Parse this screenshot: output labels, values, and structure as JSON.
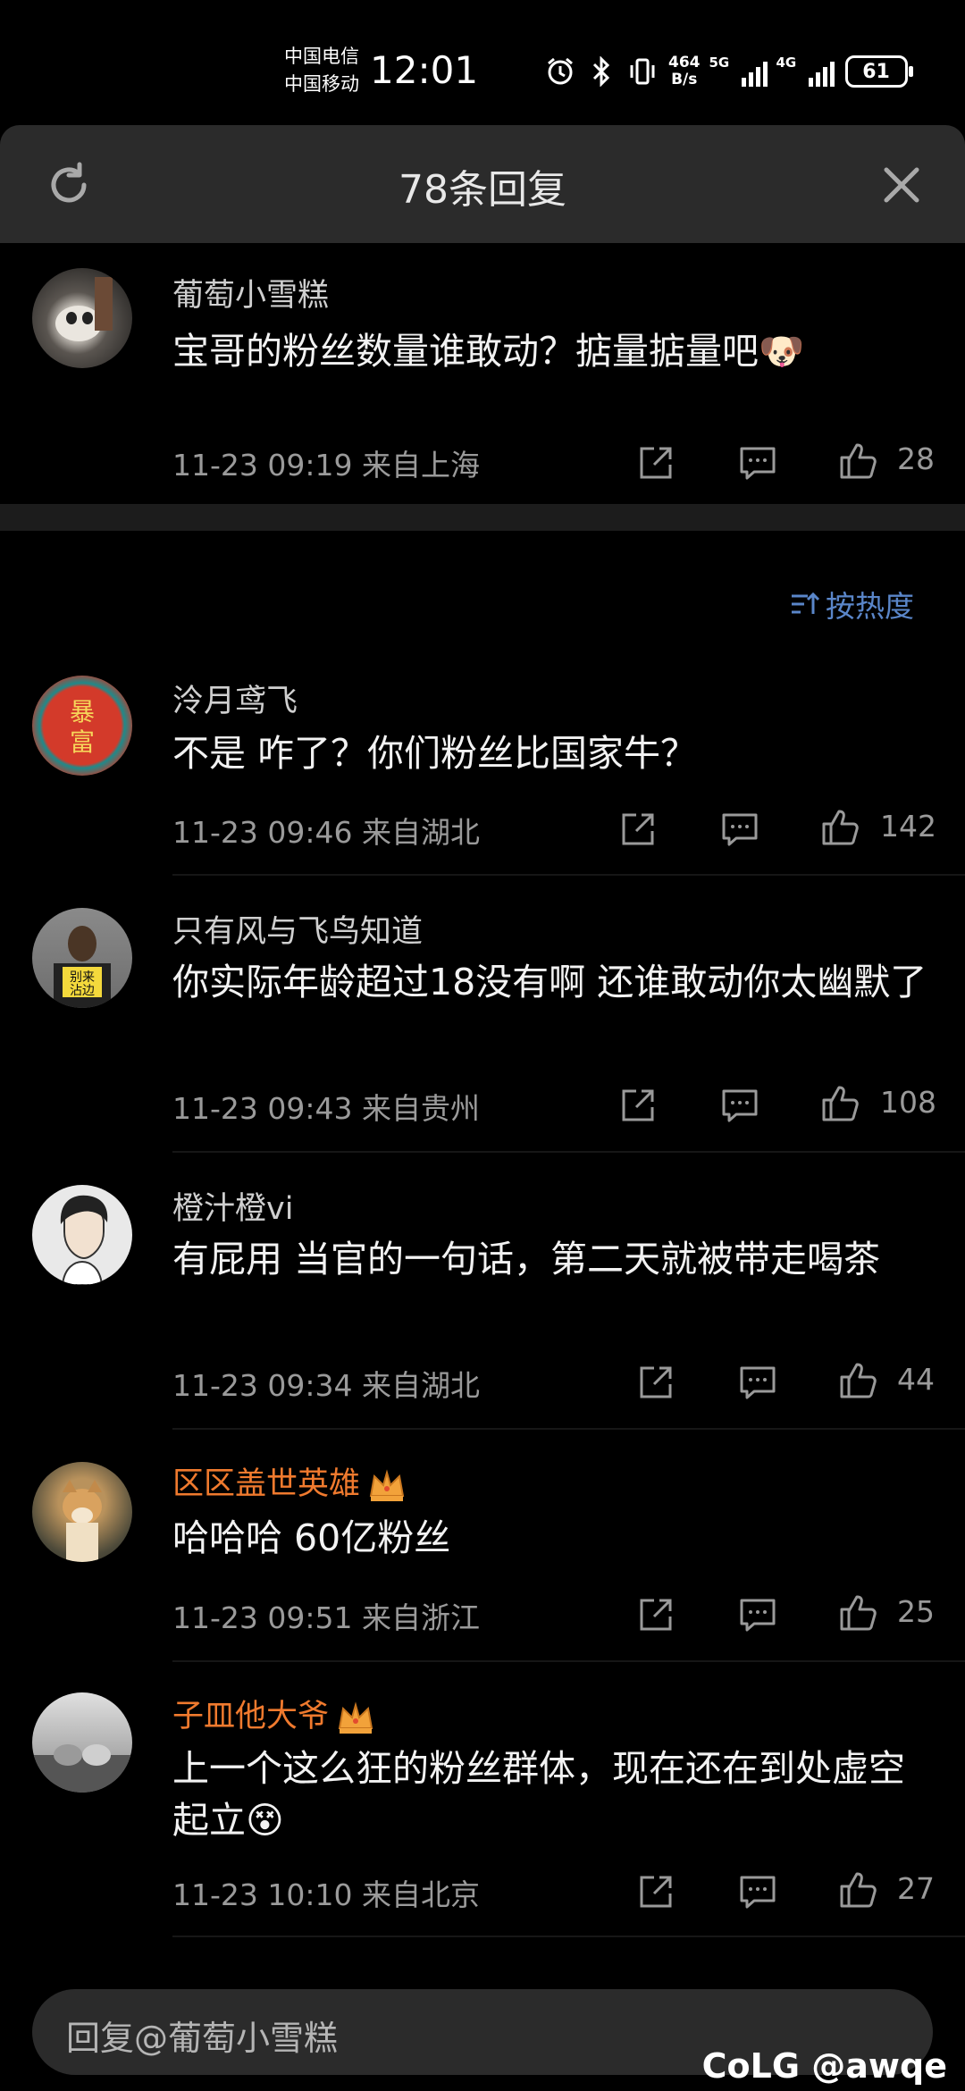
{
  "status_bar": {
    "carrier1": "中国电信",
    "carrier2": "中国移动",
    "time": "12:01",
    "net_speed_value": "464",
    "net_speed_unit": "B/s",
    "signal1": "5G",
    "signal2": "4G",
    "battery": "61"
  },
  "sheet": {
    "title": "78条回复",
    "sort_label": "按热度"
  },
  "main_comment": {
    "author": "葡萄小雪糕",
    "text": "宝哥的粉丝数量谁敢动？掂量掂量吧",
    "emoji": "🐶",
    "date": "11-23 09:19",
    "location": "来自上海",
    "likes": "28"
  },
  "replies": [
    {
      "author": "泠月鸢飞",
      "text": "不是 咋了？你们粉丝比国家牛？",
      "date": "11-23 09:46",
      "location": "来自湖北",
      "likes": "142"
    },
    {
      "author": "只有风与飞鸟知道",
      "text": "你实际年龄超过18没有啊 还谁敢动你太幽默了",
      "date": "11-23 09:43",
      "location": "来自贵州",
      "likes": "108"
    },
    {
      "author": "橙汁橙vi",
      "text": "有屁用 当官的一句话，第二天就被带走喝茶",
      "date": "11-23 09:34",
      "location": "来自湖北",
      "likes": "44"
    },
    {
      "author": "区区盖世英雄",
      "text": "哈哈哈 60亿粉丝",
      "date": "11-23 09:51",
      "location": "来自浙江",
      "likes": "25"
    },
    {
      "author": "子皿他大爷",
      "text": "上一个这么狂的粉丝群体，现在还在到处虚空起立",
      "emoji": "😵",
      "date": "11-23 10:10",
      "location": "来自北京",
      "likes": "27"
    }
  ],
  "reply_bar": {
    "placeholder": "回复@葡萄小雪糕"
  },
  "watermark": "CoLG @awqe",
  "colors": {
    "background": "#000000",
    "sheet_header": "#2b2b2b",
    "vip_name": "#f07a2e",
    "sort_link": "#5a86c9"
  },
  "icons": [
    "refresh-icon",
    "close-icon",
    "share-icon",
    "comment-icon",
    "like-icon",
    "crown-icon",
    "sort-icon"
  ]
}
